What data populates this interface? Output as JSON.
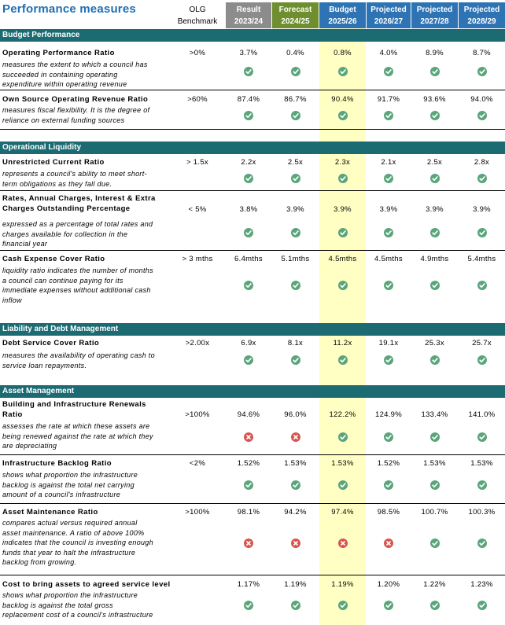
{
  "title": "Performance measures",
  "headers": {
    "olg": [
      "OLG",
      "Benchmark"
    ],
    "result": [
      "Result",
      "2023/24"
    ],
    "forecast": [
      "Forecast",
      "2024/25"
    ],
    "budget": [
      "Budget",
      "2025/26"
    ],
    "p1": [
      "Projected",
      "2026/27"
    ],
    "p2": [
      "Projected",
      "2027/28"
    ],
    "p3": [
      "Projected",
      "2028/29"
    ]
  },
  "colors": {
    "title": "#1f6fb2",
    "section": "#1c6b73",
    "check": "#5aa57a",
    "cross": "#d9534f",
    "budget_highlight": "#ffffc4"
  },
  "sections": {
    "budget": "Budget Performance",
    "liquidity": "Operational Liquidity",
    "debt": "Liability and Debt Management",
    "asset": "Asset Management"
  },
  "metrics": [
    {
      "name": [
        "Operating Performance Ratio"
      ],
      "desc": [
        "measures the extent to which a council has",
        "succeeded in containing operating",
        "expenditure within operating revenue"
      ],
      "benchmark": ">0%",
      "values": [
        "3.7%",
        "0.4%",
        "0.8%",
        "4.0%",
        "8.9%",
        "8.7%"
      ],
      "status": [
        "check",
        "check",
        "check",
        "check",
        "check",
        "check"
      ]
    },
    {
      "name": [
        "Own Source Operating Revenue Ratio"
      ],
      "desc": [
        "measures fiscal flexibility. It is the degree of",
        "reliance on external funding sources"
      ],
      "benchmark": ">60%",
      "values": [
        "87.4%",
        "86.7%",
        "90.4%",
        "91.7%",
        "93.6%",
        "94.0%"
      ],
      "status": [
        "check",
        "check",
        "check",
        "check",
        "check",
        "check"
      ]
    },
    {
      "name": [
        "Unrestricted Current Ratio"
      ],
      "desc": [
        "represents a council's ability to meet short-",
        "term obligations as they fall due."
      ],
      "benchmark": "> 1.5x",
      "values": [
        "2.2x",
        "2.5x",
        "2.3x",
        "2.1x",
        "2.5x",
        "2.8x"
      ],
      "status": [
        "check",
        "check",
        "check",
        "check",
        "check",
        "check"
      ]
    },
    {
      "name": [
        "Rates, Annual Charges, Interest & Extra",
        "Charges Outstanding Percentage"
      ],
      "desc": [
        "expressed as a percentage of total rates and",
        "charges available for collection in the",
        "financial year"
      ],
      "benchmark": "< 5%",
      "values": [
        "3.8%",
        "3.9%",
        "3.9%",
        "3.9%",
        "3.9%",
        "3.9%"
      ],
      "status": [
        "check",
        "check",
        "check",
        "check",
        "check",
        "check"
      ]
    },
    {
      "name": [
        "Cash Expense Cover Ratio"
      ],
      "desc": [
        "liquidity ratio indicates the number of months",
        "a council can continue paying for its",
        "immediate expenses without additional cash",
        "inflow"
      ],
      "benchmark": "> 3 mths",
      "values": [
        "6.4mths",
        "5.1mths",
        "4.5mths",
        "4.5mths",
        "4.9mths",
        "5.4mths"
      ],
      "status": [
        "check",
        "check",
        "check",
        "check",
        "check",
        "check"
      ]
    },
    {
      "name": [
        "Debt Service Cover Ratio"
      ],
      "desc": [
        "measures the availability of operating cash to",
        "service loan repayments."
      ],
      "benchmark": ">2.00x",
      "values": [
        "6.9x",
        "8.1x",
        "11.2x",
        "19.1x",
        "25.3x",
        "25.7x"
      ],
      "status": [
        "check",
        "check",
        "check",
        "check",
        "check",
        "check"
      ]
    },
    {
      "name": [
        "Building and Infrastructure Renewals",
        "Ratio"
      ],
      "desc": [
        "assesses the rate at which these assets are",
        "being renewed against the rate at which they",
        "are depreciating"
      ],
      "benchmark": ">100%",
      "values": [
        "94.6%",
        "96.0%",
        "122.2%",
        "124.9%",
        "133.4%",
        "141.0%"
      ],
      "status": [
        "cross",
        "cross",
        "check",
        "check",
        "check",
        "check"
      ]
    },
    {
      "name": [
        "Infrastructure Backlog Ratio"
      ],
      "desc": [
        "shows what proportion the infrastructure",
        "backlog is against the total net carrying",
        "amount of a council's infrastructure"
      ],
      "benchmark": "<2%",
      "values": [
        "1.52%",
        "1.53%",
        "1.53%",
        "1.52%",
        "1.53%",
        "1.53%"
      ],
      "status": [
        "check",
        "check",
        "check",
        "check",
        "check",
        "check"
      ]
    },
    {
      "name": [
        "Asset Maintenance Ratio"
      ],
      "desc": [
        "compares actual versus required annual",
        "asset maintenance. A ratio of above 100%",
        "indicates that the council is investing enough",
        "funds that year to halt the infrastructure",
        "backlog from growing."
      ],
      "benchmark": ">100%",
      "values": [
        "98.1%",
        "94.2%",
        "97.4%",
        "98.5%",
        "100.7%",
        "100.3%"
      ],
      "status": [
        "cross",
        "cross",
        "cross",
        "cross",
        "check",
        "check"
      ]
    },
    {
      "name": [
        "Cost to bring assets to agreed service level"
      ],
      "desc": [
        "shows what proportion the infrastructure",
        "backlog is against the total gross",
        "replacement cost of a council's infrastructure"
      ],
      "benchmark": "",
      "values": [
        "1.17%",
        "1.19%",
        "1.19%",
        "1.20%",
        "1.22%",
        "1.23%"
      ],
      "status": [
        "check",
        "check",
        "check",
        "check",
        "check",
        "check"
      ]
    }
  ]
}
